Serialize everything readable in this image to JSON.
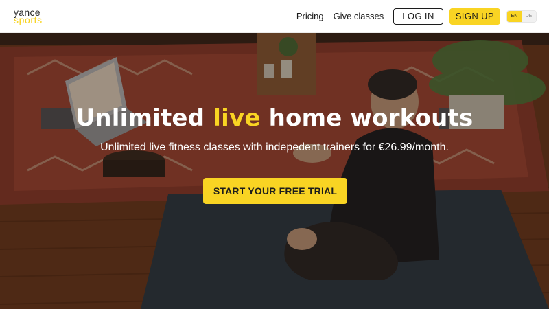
{
  "brand": {
    "line1": "yance",
    "line2": "sports"
  },
  "nav": {
    "pricing": "Pricing",
    "give_classes": "Give classes",
    "login": "LOG IN",
    "signup": "SIGN UP",
    "languages": [
      "EN",
      "DE"
    ],
    "active_language": "EN"
  },
  "hero": {
    "title_before": "Unlimited ",
    "title_highlight": "live",
    "title_after": " home workouts",
    "subtitle": "Unlimited live fitness classes with indepedent trainers for €26.99/month.",
    "cta": "START YOUR FREE TRIAL"
  },
  "colors": {
    "accent": "#f9d423",
    "text_dark": "#1c1c1c"
  }
}
